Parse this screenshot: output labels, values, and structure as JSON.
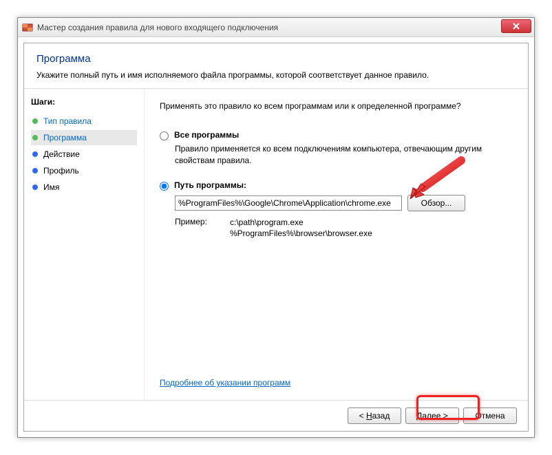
{
  "window": {
    "title": "Мастер создания правила для нового входящего подключения"
  },
  "header": {
    "title": "Программа",
    "description": "Укажите полный путь и имя исполняемого файла программы, которой соответствует данное правило."
  },
  "sidebar": {
    "heading": "Шаги:",
    "steps": [
      {
        "label": "Тип правила",
        "state": "done"
      },
      {
        "label": "Программа",
        "state": "current"
      },
      {
        "label": "Действие",
        "state": "pending"
      },
      {
        "label": "Профиль",
        "state": "pending"
      },
      {
        "label": "Имя",
        "state": "pending"
      }
    ]
  },
  "main": {
    "question": "Применять это правило ко всем программам или к определенной программе?",
    "option_all": {
      "label": "Все программы",
      "description": "Правило применяется ко всем подключениям компьютера, отвечающим другим свойствам правила."
    },
    "option_path": {
      "label": "Путь программы:",
      "value": "%ProgramFiles%\\Google\\Chrome\\Application\\chrome.exe",
      "browse": "Обзор...",
      "example_label": "Пример:",
      "example1": "c:\\path\\program.exe",
      "example2": "%ProgramFiles%\\browser\\browser.exe"
    },
    "learn_more": "Подробнее об указании программ"
  },
  "footer": {
    "back": "< Назад",
    "next": "Далее >",
    "cancel": "Отмена"
  },
  "annotations": {
    "highlight_next": true,
    "arrow_to_input": true
  }
}
